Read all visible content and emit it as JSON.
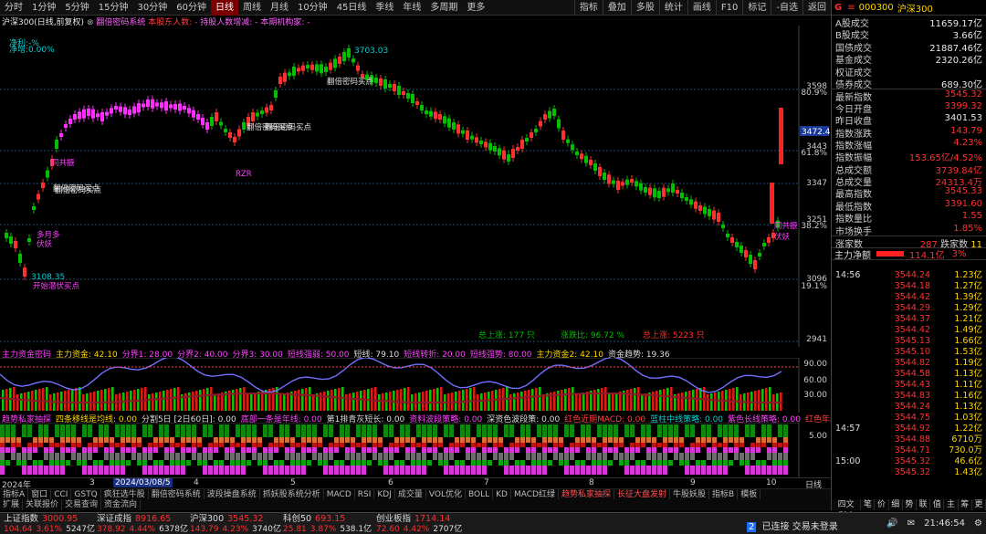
{
  "toolbar": {
    "periods": [
      "分时",
      "1分钟",
      "5分钟",
      "15分钟",
      "30分钟",
      "60分钟",
      "日线",
      "周线",
      "月线",
      "10分钟",
      "45日线",
      "季线",
      "年线",
      "多周期",
      "更多"
    ],
    "active_period": 6,
    "tools": [
      "指标",
      "叠加",
      "多股",
      "统计",
      "画线",
      "F10",
      "标记",
      "-自选",
      "返回"
    ]
  },
  "chart_header": {
    "index_name": "沪深300(日线,前复权)",
    "indicator": "翻倍密码系统",
    "holders": "本股东人数: -",
    "holder_change": "持股人数增减: -",
    "institution": "本期机构家: -"
  },
  "chart_labels": {
    "net_profit": "净利:-%",
    "net_rate": "净增:0.00%",
    "price_high_label": "3703.03",
    "price_low_label": "3108.35",
    "total_up": "总上涨: 177 只",
    "up_ratio": "涨跌比: 96.72 %",
    "total_down": "总上涨: 5223 只",
    "current_price_tag": "3472.4",
    "annotations": [
      "翻倍密码买点",
      "翻倍密码买点",
      "翻倍密码买点",
      "翻倍密码买点",
      "翻倍密码买点",
      "开始潜伏买点",
      "同共振",
      "同共振",
      "伏妖",
      "伏妖",
      "多月多",
      "RZR"
    ]
  },
  "y_axis": {
    "labels": [
      "3598",
      "80.9%",
      "3443",
      "61.8%",
      "3347",
      "3251",
      "38.2%",
      "3096",
      "19.1%",
      "2941"
    ]
  },
  "sub1": {
    "header": "主力资金密码",
    "items": [
      "主力资金: 42.10",
      "分界1: 28.00",
      "分界2: 40.00",
      "分界3: 30.00",
      "短线强弱: 50.00",
      "短线: 79.10",
      "短线转折: 20.00",
      "短线强势: 80.00",
      "主力资金2: 42.10",
      "资金趋势: 19.36"
    ],
    "axis": [
      "90.00",
      "60.00",
      "30.00"
    ]
  },
  "sub2": {
    "header": "趋势私家抽探",
    "items": [
      "四条移线是均线: 0.00",
      "分割5日 [2日60日]: 0.00",
      "底部一条是年线: 0.00",
      "第1排青灰短长: 0.00",
      "资料波段策略: 0.00",
      "深资色波段策: 0.00",
      "红色近期MACD: 0.00",
      "蓝柱中线策略: 0.00",
      "紫色长线策略: 0.00",
      "红色年线"
    ],
    "axis": [
      "5.00"
    ]
  },
  "x_axis": {
    "labels": [
      "2024年",
      "3",
      "4",
      "5",
      "6",
      "7",
      "8",
      "9",
      "10",
      "11",
      "12"
    ],
    "selected_date": "2024/03/08/5",
    "period_tag": "日线"
  },
  "indicator_tabs": [
    "指标A",
    "窗口",
    "CCI",
    "GSTQ",
    "疯狂选牛股",
    "翻倍密码系统",
    "波段操盘系统",
    "抓妖股系统分析",
    "MACD",
    "RSI",
    "KDJ",
    "成交量",
    "VOL优化",
    "BOLL",
    "KD",
    "MACD红绿",
    "趋势私家抽探",
    "长征大盘发射",
    "牛股妖股",
    "指标B",
    "模板"
  ],
  "bottom_tabs": [
    "扩展",
    "关联报价",
    "交易查询",
    "资金流向"
  ],
  "quote": {
    "code": "000300",
    "name": "沪深300",
    "rows": [
      {
        "k": "A股成交",
        "v": "11659.17亿",
        "c": "wht"
      },
      {
        "k": "B股成交",
        "v": "3.66亿",
        "c": "wht"
      },
      {
        "k": "国债成交",
        "v": "21887.46亿",
        "c": "wht"
      },
      {
        "k": "基金成交",
        "v": "2320.26亿",
        "c": "wht"
      },
      {
        "k": "权证成交",
        "v": "",
        "c": "wht"
      },
      {
        "k": "债券成交",
        "v": "689.30亿",
        "c": "wht"
      },
      {
        "k": "最新指数",
        "v": "3545.32",
        "c": "red"
      },
      {
        "k": "今日开盘",
        "v": "3399.32",
        "c": "red"
      },
      {
        "k": "昨日收盘",
        "v": "3401.53",
        "c": "wht"
      },
      {
        "k": "指数涨跌",
        "v": "143.79",
        "c": "red"
      },
      {
        "k": "指数涨幅",
        "v": "4.23%",
        "c": "red"
      },
      {
        "k": "指数振幅",
        "v": "153.65亿/4.52%",
        "c": "red"
      },
      {
        "k": "总成交额",
        "v": "3739.84亿",
        "c": "red"
      },
      {
        "k": "总成交量",
        "v": "24313.4万",
        "c": "red"
      },
      {
        "k": "最高指数",
        "v": "3545.33",
        "c": "red"
      },
      {
        "k": "最低指数",
        "v": "3391.60",
        "c": "red"
      },
      {
        "k": "指数量比",
        "v": "1.55",
        "c": "red"
      },
      {
        "k": "市场换手",
        "v": "1.85%",
        "c": "red"
      }
    ],
    "up_count_label": "涨家数",
    "up_count": "287",
    "down_count_label": "跌家数",
    "down_count": "11",
    "main_net_label": "主力净额",
    "main_net": "114.1亿",
    "main_net_pct": "3%"
  },
  "ticks": [
    {
      "t": "14:56",
      "p": "3544.24",
      "q": "1.23亿",
      "g": false
    },
    {
      "t": "",
      "p": "3544.18",
      "q": "1.27亿",
      "g": false
    },
    {
      "t": "",
      "p": "3544.42",
      "q": "1.39亿",
      "g": false
    },
    {
      "t": "",
      "p": "3544.29",
      "q": "1.29亿",
      "g": false
    },
    {
      "t": "",
      "p": "3544.37",
      "q": "1.21亿",
      "g": false
    },
    {
      "t": "",
      "p": "3544.42",
      "q": "1.49亿",
      "g": false
    },
    {
      "t": "",
      "p": "3545.13",
      "q": "1.66亿",
      "g": false
    },
    {
      "t": "",
      "p": "3545.10",
      "q": "1.53亿",
      "g": false
    },
    {
      "t": "",
      "p": "3544.82",
      "q": "1.19亿",
      "g": false
    },
    {
      "t": "",
      "p": "3544.58",
      "q": "1.13亿",
      "g": false
    },
    {
      "t": "",
      "p": "3544.43",
      "q": "1.11亿",
      "g": false
    },
    {
      "t": "",
      "p": "3544.83",
      "q": "1.16亿",
      "g": false
    },
    {
      "t": "",
      "p": "3544.24",
      "q": "1.13亿",
      "g": false
    },
    {
      "t": "",
      "p": "3544.75",
      "q": "1.03亿",
      "g": false
    },
    {
      "t": "14:57",
      "p": "3544.92",
      "q": "1.22亿",
      "g": false
    },
    {
      "t": "",
      "p": "3544.88",
      "q": "6710万",
      "g": false
    },
    {
      "t": "",
      "p": "3544.71",
      "q": "730.0万",
      "g": false
    },
    {
      "t": "15:00",
      "p": "3545.32",
      "q": "46.6亿",
      "g": false
    },
    {
      "t": "",
      "p": "3545.32",
      "q": "1.43亿",
      "g": false
    }
  ],
  "right_tabs": [
    "笔",
    "价",
    "细",
    "势",
    "联",
    "值",
    "主",
    "筹",
    "更"
  ],
  "right_side_label": "四文F10",
  "status_bar": [
    {
      "name": "上证指数",
      "value": "3000.95",
      "pct": "3.61%",
      "chg": "104.64",
      "vol": "5247亿"
    },
    {
      "name": "深证成指",
      "value": "8916.65",
      "pct": "4.44%",
      "chg": "378.92",
      "vol": "6378亿"
    },
    {
      "name": "沪深300",
      "value": "3545.32",
      "pct": "4.23%",
      "chg": "143.79",
      "vol": "3740亿"
    },
    {
      "name": "科创50",
      "value": "693.15",
      "pct": "3.87%",
      "chg": "25.81",
      "vol": "538.1亿"
    },
    {
      "name": "创业板指",
      "value": "1714.14",
      "pct": "4.42%",
      "chg": "72.60",
      "vol": "2707亿"
    }
  ],
  "connection": {
    "badge": "2",
    "text": "已连接 交易未登录"
  },
  "clock": "21:46:54",
  "colors": {
    "up": "#ff3030",
    "down": "#00c000",
    "accent": "#ffd700",
    "magenta": "#ff40ff",
    "cyan": "#00d0d0"
  }
}
